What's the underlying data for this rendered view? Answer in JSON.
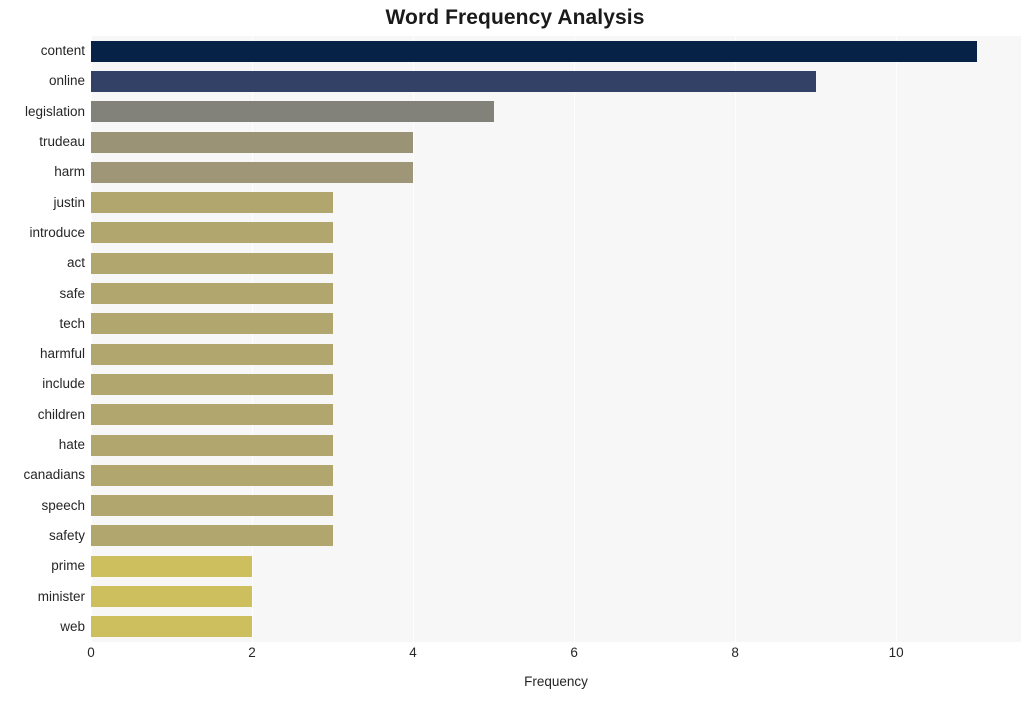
{
  "chart_data": {
    "type": "bar",
    "orientation": "horizontal",
    "title": "Word Frequency Analysis",
    "xlabel": "Frequency",
    "ylabel": "",
    "xlim": [
      0,
      11.55
    ],
    "xticks": [
      0,
      2,
      4,
      6,
      8,
      10
    ],
    "grid": true,
    "grid_axis": "x",
    "legend": null,
    "categories": [
      "content",
      "online",
      "legislation",
      "trudeau",
      "harm",
      "justin",
      "introduce",
      "act",
      "safe",
      "tech",
      "harmful",
      "include",
      "children",
      "hate",
      "canadians",
      "speech",
      "safety",
      "prime",
      "minister",
      "web"
    ],
    "values": [
      11,
      9,
      5,
      4,
      4,
      3,
      3,
      3,
      3,
      3,
      3,
      3,
      3,
      3,
      3,
      3,
      3,
      2,
      2,
      2
    ],
    "bar_colors": [
      "#062347",
      "#344166",
      "#83827a",
      "#9b9375",
      "#9e9676",
      "#b0a66e",
      "#b0a66e",
      "#b0a66e",
      "#b0a66e",
      "#b0a66e",
      "#b0a66e",
      "#b0a66e",
      "#b0a66e",
      "#b0a66e",
      "#b0a66e",
      "#b0a66e",
      "#b0a66e",
      "#cdbf5e",
      "#cdbf5e",
      "#cdbf5e"
    ],
    "plot_background": "#f7f7f7",
    "figure_background": "#ffffff",
    "text_color": "#262626"
  }
}
